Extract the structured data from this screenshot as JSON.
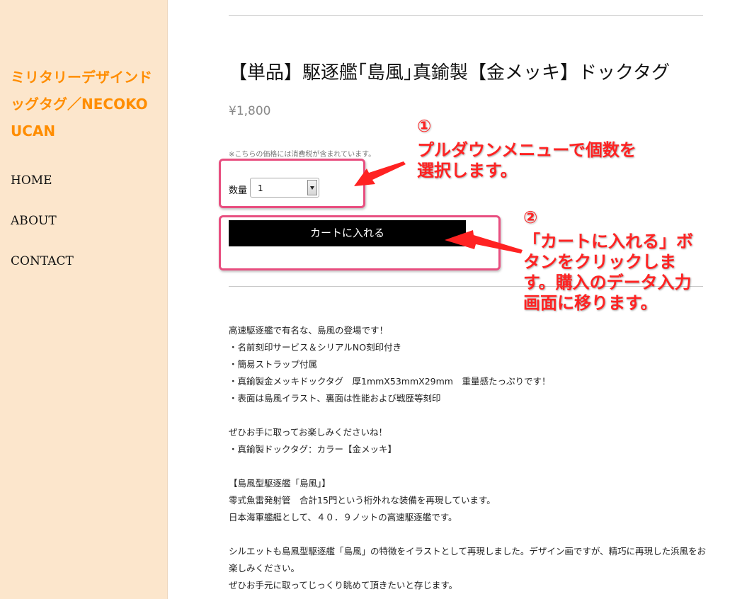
{
  "sidebar": {
    "site_title": "ミリタリーデザインドッグタグ／NECOKOUCAN",
    "nav": [
      {
        "label": "HOME"
      },
      {
        "label": "ABOUT"
      },
      {
        "label": "CONTACT"
      }
    ]
  },
  "product": {
    "title": "【単品】駆逐艦｢島風｣真鍮製【金メッキ】ドックタグ",
    "price": "¥1,800",
    "tax_note": "※こちらの価格には消費税が含まれています。",
    "quantity_label": "数量",
    "quantity_value": "1",
    "cart_button_label": "カートに入れる"
  },
  "description": [
    "高速駆逐艦で有名な、島風の登場です！",
    "・名前刻印サービス＆シリアルNO刻印付き",
    "・簡易ストラップ付属",
    "・真鍮製金メッキドックタグ　厚1mmX53mmX29mm　重量感たっぷりです！",
    "・表面は島風イラスト、裏面は性能および戦歴等刻印",
    "",
    "ぜひお手に取ってお楽しみくださいね！",
    "・真鍮製ドックタグ：カラー【金メッキ】",
    "",
    "【島風型駆逐艦「島風」】",
    "零式魚雷発射管　合計15門という桁外れな装備を再現しています。",
    "日本海軍艦艇として、４０．９ノットの高速駆逐艦です。",
    "",
    "シルエットも島風型駆逐艦「島風」の特徴をイラストとして再現しました。デザイン画ですが、精巧に再現した浜風をお楽しみください。",
    "ぜひお手元に取ってじっくり眺めて頂きたいと存じます。"
  ],
  "annotations": {
    "step1_number": "①",
    "step1_text": "プルダウンメニューで個数を選択します。",
    "step2_number": "②",
    "step2_text": "「カートに入れる」ボタンをクリックします。購入のデータ入力画面に移ります。",
    "color": "#ff2222",
    "box_color": "#e84f80"
  },
  "colors": {
    "sidebar_bg": "#fce6cc",
    "site_title": "#ff8d00",
    "button_bg": "#000000"
  }
}
